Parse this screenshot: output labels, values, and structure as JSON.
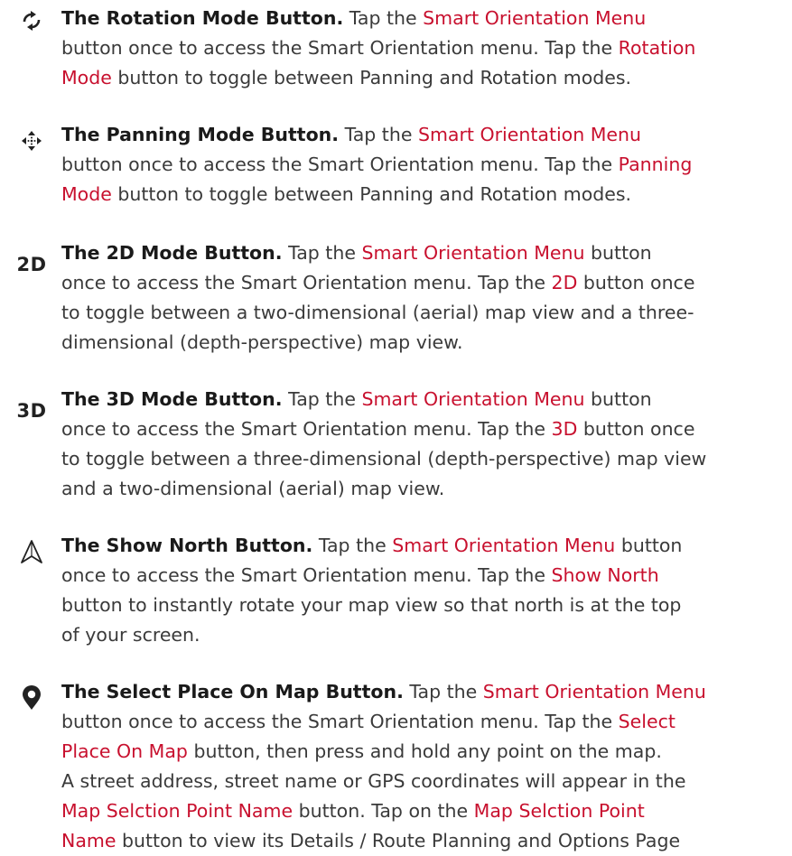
{
  "entries": [
    {
      "icon": "rotate-icon",
      "title": "The Rotation Mode Button.",
      "l1a": "Tap the ",
      "l1b": "Smart Orientation Menu",
      "l2a": "button once to access the Smart Orientation menu. Tap the ",
      "l2b": "Rotation",
      "l3a": "Mode",
      "l3b": " button to toggle between Panning and Rotation modes."
    },
    {
      "icon": "pan-arrows-icon",
      "title": "The Panning Mode Button.",
      "l1a": "Tap the ",
      "l1b": "Smart Orientation Menu",
      "l2a": "button once to access the Smart Orientation menu. Tap the ",
      "l2b": "Panning",
      "l3a": "Mode",
      "l3b": " button to toggle between Panning and Rotation modes."
    },
    {
      "icon_text": "2D",
      "title": "The 2D Mode Button.",
      "l1a": "Tap the ",
      "l1b": "Smart Orientation Menu",
      "l1c": " button",
      "l2a": "once to access the Smart Orientation menu. Tap the ",
      "l2b": "2D",
      "l2c": " button once",
      "l3": "to toggle between a two-dimensional (aerial) map view and a three-",
      "l4": "dimensional (depth-perspective) map view."
    },
    {
      "icon_text": "3D",
      "title": "The 3D Mode Button.",
      "l1a": "Tap the ",
      "l1b": "Smart Orientation Menu",
      "l1c": " button",
      "l2a": "once to access the Smart Orientation menu. Tap the ",
      "l2b": "3D",
      "l2c": " button once",
      "l3": "to toggle between a three-dimensional (depth-perspective) map view",
      "l4": "and a two-dimensional (aerial) map view."
    },
    {
      "icon": "north-arrow-icon",
      "title": "The Show North Button.",
      "l1a": "Tap the ",
      "l1b": "Smart Orientation Menu",
      "l1c": " button",
      "l2a": "once to access the Smart Orientation menu. Tap the ",
      "l2b": "Show North",
      "l3": "button to instantly rotate your map view so that north is at the top",
      "l4": "of your screen."
    },
    {
      "icon": "map-pin-icon",
      "title": "The Select Place On Map Button.",
      "l1a": "Tap the ",
      "l1b": "Smart Orientation Menu",
      "l2a": "button once to access the Smart Orientation menu. Tap the ",
      "l2b": "Select",
      "l3a": "Place On Map",
      "l3b": " button, then press and hold any point on the map.",
      "l4": "A street address, street name or GPS coordinates will appear in the",
      "l5a": "Map Selction Point Name",
      "l5b": " button. Tap on the ",
      "l5c": "Map Selction Point",
      "l6a": "Name",
      "l6b": " button to view its Details / Route Planning and Options Page"
    }
  ],
  "colors": {
    "highlight": "#c8102e",
    "text": "#3a3a3a",
    "heading": "#1a1a1a"
  }
}
